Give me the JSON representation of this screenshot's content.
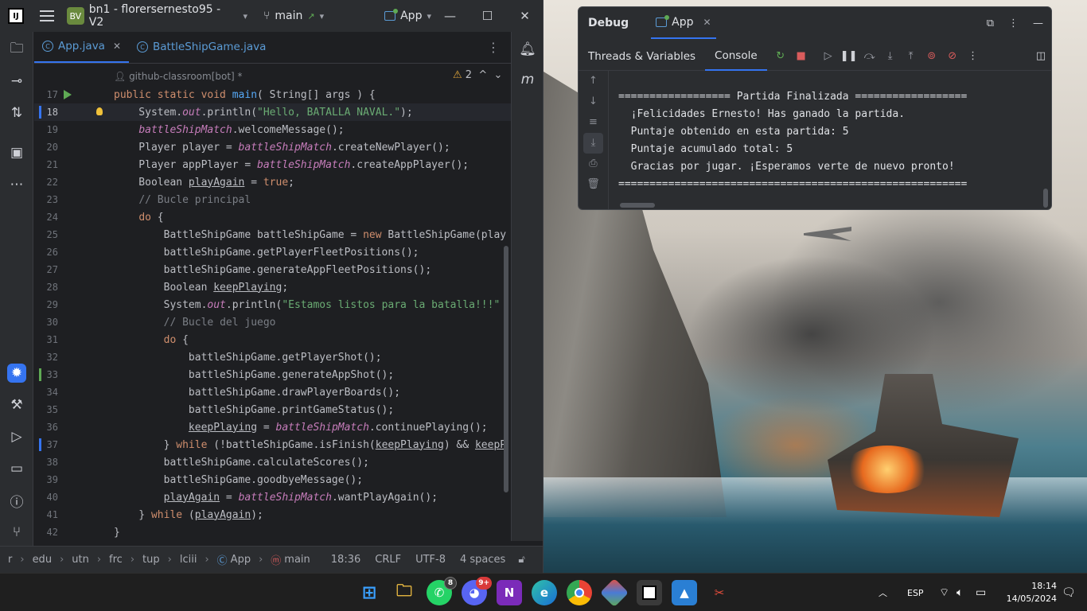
{
  "ide": {
    "logo": "IJ",
    "project_badge": "BV",
    "project_name": "bn1 - florersernesto95 - V2",
    "branch": "main",
    "run_config": "App",
    "tabs": [
      {
        "label": "App.java",
        "active": true
      },
      {
        "label": "BattleShipGame.java",
        "active": false
      }
    ],
    "author": "github-classroom[bot] *",
    "warnings_count": "2",
    "code_lines": [
      {
        "n": "17",
        "html": "<span class=\"kw\">public static void</span> <span class=\"fn\">main</span>( String[] args ) {"
      },
      {
        "n": "18",
        "html": "    System.<span class=\"fld\">out</span>.println(<span class=\"str\">\"Hello, BATALLA NAVAL.\"</span>);"
      },
      {
        "n": "19",
        "html": "    <span class=\"fld\">battleShipMatch</span>.welcomeMessage();"
      },
      {
        "n": "20",
        "html": "    Player player = <span class=\"fld\">battleShipMatch</span>.createNewPlayer();"
      },
      {
        "n": "21",
        "html": "    Player appPlayer = <span class=\"fld\">battleShipMatch</span>.createAppPlayer();"
      },
      {
        "n": "22",
        "html": "    Boolean <span class=\"ul\">playAgain</span> = <span class=\"kw\">true</span>;"
      },
      {
        "n": "23",
        "html": "    <span class=\"cmt\">// Bucle principal</span>"
      },
      {
        "n": "24",
        "html": "    <span class=\"kw\">do</span> {"
      },
      {
        "n": "25",
        "html": "        BattleShipGame battleShipGame = <span class=\"kw\">new</span> BattleShipGame(play"
      },
      {
        "n": "26",
        "html": "        battleShipGame.getPlayerFleetPositions();"
      },
      {
        "n": "27",
        "html": "        battleShipGame.generateAppFleetPositions();"
      },
      {
        "n": "28",
        "html": "        Boolean <span class=\"ul\">keepPlaying</span>;"
      },
      {
        "n": "29",
        "html": "        System.<span class=\"fld\">out</span>.println(<span class=\"str\">\"Estamos listos para la batalla!!!\"</span>"
      },
      {
        "n": "30",
        "html": "        <span class=\"cmt\">// Bucle del juego</span>"
      },
      {
        "n": "31",
        "html": "        <span class=\"kw\">do</span> {"
      },
      {
        "n": "32",
        "html": "            battleShipGame.getPlayerShot();"
      },
      {
        "n": "33",
        "html": "            battleShipGame.generateAppShot();"
      },
      {
        "n": "34",
        "html": "            battleShipGame.drawPlayerBoards();"
      },
      {
        "n": "35",
        "html": "            battleShipGame.printGameStatus();"
      },
      {
        "n": "36",
        "html": "            <span class=\"ul\">keepPlaying</span> = <span class=\"fld\">battleShipMatch</span>.continuePlaying();"
      },
      {
        "n": "37",
        "html": "        } <span class=\"kw\">while</span> (!battleShipGame.isFinish(<span class=\"ul\">keepPlaying</span>) &amp;&amp; <span class=\"ul\">keepP</span>"
      },
      {
        "n": "38",
        "html": "        battleShipGame.calculateScores();"
      },
      {
        "n": "39",
        "html": "        battleShipGame.goodbyeMessage();"
      },
      {
        "n": "40",
        "html": "        <span class=\"ul\">playAgain</span> = <span class=\"fld\">battleShipMatch</span>.wantPlayAgain();"
      },
      {
        "n": "41",
        "html": "    } <span class=\"kw\">while</span> (<span class=\"ul\">playAgain</span>);"
      },
      {
        "n": "42",
        "html": "}"
      }
    ],
    "status": {
      "breadcrumb": [
        "r",
        "edu",
        "utn",
        "frc",
        "tup",
        "lciii",
        "App",
        "main"
      ],
      "position": "18:36",
      "line_ending": "CRLF",
      "encoding": "UTF-8",
      "indent": "4 spaces"
    }
  },
  "debug": {
    "title": "Debug",
    "tab": "App",
    "subtabs": [
      "Threads & Variables",
      "Console"
    ],
    "console_lines": [
      "================== Partida Finalizada ==================",
      "  ¡Felicidades Ernesto! Has ganado la partida.",
      "  Puntaje obtenido en esta partida: 5",
      "  Puntaje acumulado total: 5",
      "  Gracias por jugar. ¡Esperamos verte de nuevo pronto!",
      "========================================================"
    ]
  },
  "taskbar": {
    "whatsapp_badge": "8",
    "discord_badge": "9+",
    "language": "ESP",
    "time": "18:14",
    "date": "14/05/2024"
  },
  "colors": {
    "accent": "#3574f0",
    "editor_bg": "#1e1f22",
    "panel_bg": "#2b2d30",
    "keyword": "#cf8e6d",
    "string": "#6aab73"
  }
}
